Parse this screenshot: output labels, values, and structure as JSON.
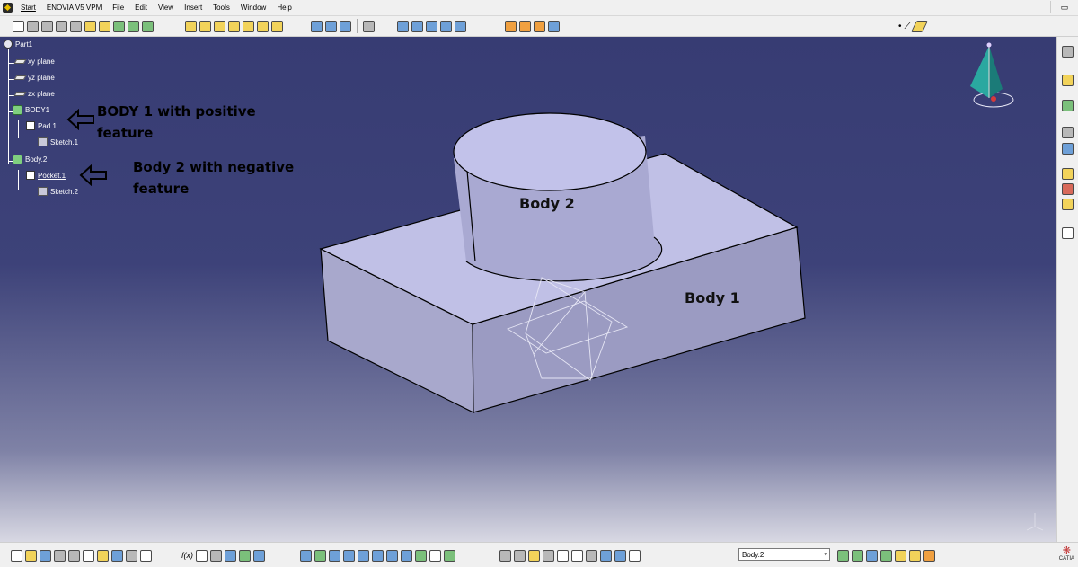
{
  "menu": {
    "items": [
      "Start",
      "ENOVIA V5 VPM",
      "File",
      "Edit",
      "View",
      "Insert",
      "Tools",
      "Window",
      "Help"
    ]
  },
  "tree": {
    "root": "Part1",
    "planes": [
      "xy plane",
      "yz plane",
      "zx plane"
    ],
    "body1": {
      "label": "BODY1",
      "feature": "Pad.1",
      "sketch": "Sketch.1"
    },
    "body2": {
      "label": "Body.2",
      "feature": "Pocket.1",
      "sketch": "Sketch.2"
    }
  },
  "annotations": {
    "body1_line1": "BODY 1 with positive",
    "body1_line2": "feature",
    "body2_line1": "Body 2 with negative",
    "body2_line2": "feature"
  },
  "scene": {
    "body1_label": "Body 1",
    "body2_label": "Body 2"
  },
  "bottom": {
    "current_body": "Body.2",
    "brand": "CATIA"
  }
}
